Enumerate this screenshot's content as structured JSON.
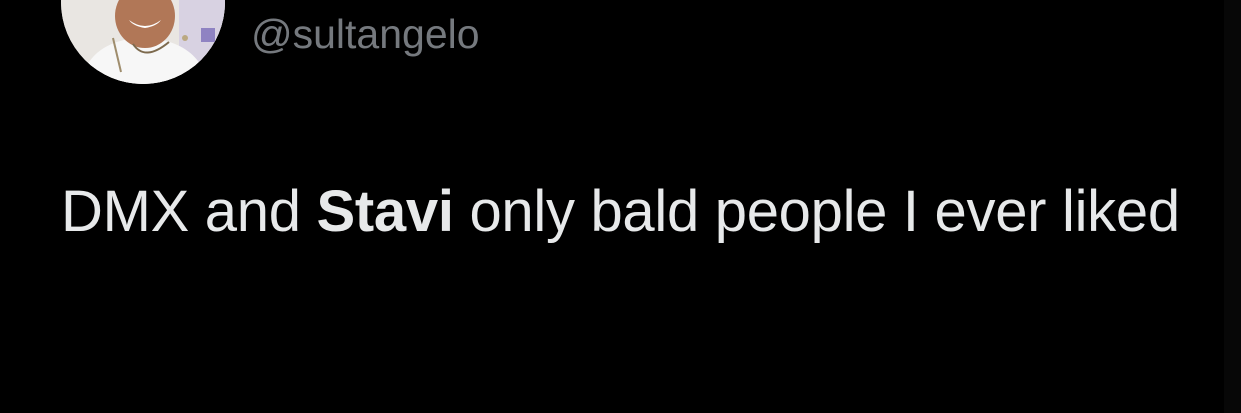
{
  "tweet": {
    "handle": "@sultangelo",
    "text_before": "DMX and ",
    "text_bold": "Stavi",
    "text_after": " only bald people I ever liked",
    "avatar_icon": "profile-photo-avatar"
  },
  "colors": {
    "background": "#000000",
    "handle": "#75797e",
    "text": "#e7e9ea"
  }
}
